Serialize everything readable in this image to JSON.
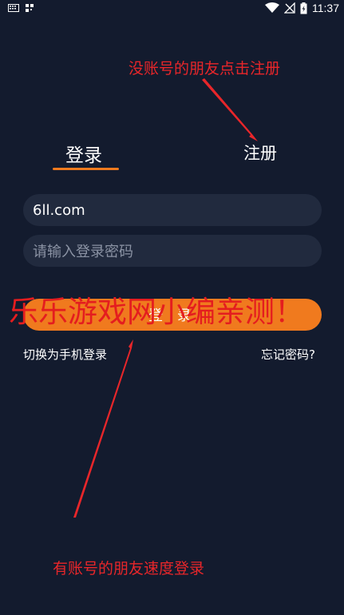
{
  "status_bar": {
    "time": "11:37",
    "icons": [
      "keyboard-icon",
      "qr-icon",
      "wifi-icon",
      "no-signal-icon",
      "battery-icon"
    ]
  },
  "annotations": {
    "top": "没账号的朋友点击注册",
    "bottom": "有账号的朋友速度登录",
    "watermark": "乐乐游戏网小编亲测！"
  },
  "tabs": {
    "login": "登录",
    "register": "注册"
  },
  "form": {
    "account_value": "6ll.com",
    "password_placeholder": "请输入登录密码"
  },
  "login_button": "登 录",
  "links": {
    "switch_phone": "切换为手机登录",
    "forgot_password": "忘记密码?"
  },
  "colors": {
    "background": "#131b2e",
    "accent": "#f07a1e",
    "annotation": "#e8262a"
  }
}
